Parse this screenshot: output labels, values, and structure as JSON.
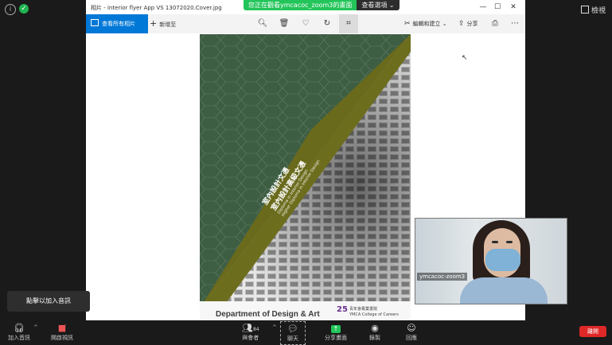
{
  "zoom_top": {
    "view_label": "檢視",
    "share_banner_text": "您正在觀看ymcacoc_zoom3的畫面",
    "view_options_label": "查看選項"
  },
  "photos_window": {
    "title": "相片 - interior flyer App VS 13072020.Cover.jpg",
    "controls": {
      "minimize": "—",
      "maximize": "☐",
      "close": "✕"
    },
    "toolbar": {
      "see_all_label": "查看所有相片",
      "add_to_label": "新增至",
      "edit_create_label": "編輯和建立",
      "share_label": "分享"
    }
  },
  "cover": {
    "department": "Department of Design & Art",
    "college_cn": "青年會專業書院",
    "college_en": "YMCA College of Careers",
    "logo_mark": "25",
    "diagonal_cn_1": "室內設計文憑",
    "diagonal_cn_2": "室內設計高級文憑",
    "diagonal_en_1": "Diploma in Interior Design",
    "diagonal_en_2": "Higher Diploma in Interior Design",
    "colors": {
      "green": "#3e5e44",
      "olive": "#6a6a1c"
    }
  },
  "video": {
    "participant_name": "ymcacoc-zoom3"
  },
  "tooltip": {
    "text": "點擊以加入音訊"
  },
  "zoom_bar": {
    "join_audio": "加入音訊",
    "start_video": "開啟視訊",
    "participants": "與會者",
    "participant_count": "84",
    "chat": "聊天",
    "share_screen": "分享畫面",
    "record": "錄製",
    "reactions": "回應",
    "leave": "離開",
    "colors": {
      "share": "#23c55a",
      "leave": "#e02828"
    }
  }
}
